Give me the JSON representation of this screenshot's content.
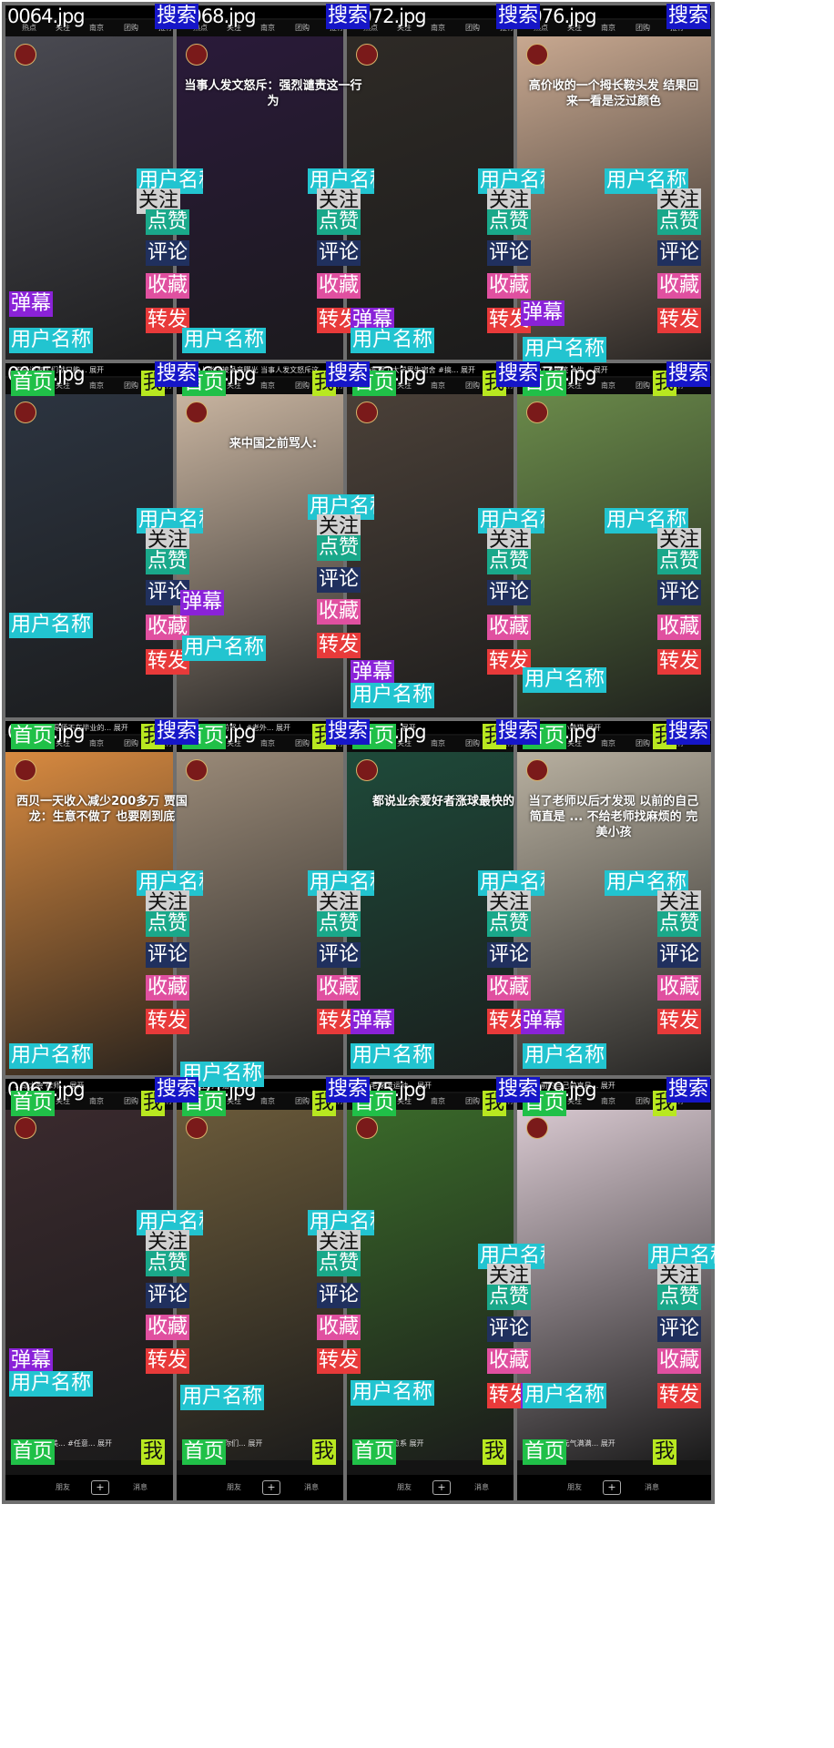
{
  "labels": {
    "search": "搜索",
    "user": "用户名称",
    "follow": "关注",
    "like": "点赞",
    "comment": "评论",
    "favorite": "收藏",
    "share": "转发",
    "danmu": "弹幕",
    "home": "首页",
    "me": "我"
  },
  "nav_tabs": [
    "热点",
    "关注",
    "南京",
    "团购",
    "推荐"
  ],
  "bottom_nav": [
    "朋友",
    "消息"
  ],
  "cells": [
    {
      "file": "0064.jpg",
      "bg": "#4a4a52",
      "text": "",
      "caption": "不是说家人们就只能... 展开"
    },
    {
      "file": "0068.jpg",
      "bg": "#2a1a3a",
      "text": "当事人发文怒斥：强烈谴责这一行为",
      "caption": "...私人谈话被录音曝光 当事人发文怒斥这一... 展开"
    },
    {
      "file": "0072.jpg",
      "bg": "#2e2a26",
      "text": "",
      "caption": "...山东理工大学男生宿舍 #搞... 展开"
    },
    {
      "file": "0076.jpg",
      "bg": "#c8a890",
      "text": "高价收的一个拇长鞍头发 结果回来一看是泛过颜色",
      "caption": "...烫了#搞笑 #生... 展开"
    },
    {
      "file": "0065.jpg",
      "bg": "#2c3440",
      "text": "",
      "caption": "不能硬碰了 是师不在毕业的... 展开"
    },
    {
      "file": "0069.jpg",
      "bg": "#c8b4a0",
      "text": "来中国之前骂人:",
      "caption": "...在中国之前骂人 #老外... 展开"
    },
    {
      "file": "0073.jpg",
      "bg": "#4a4038",
      "text": "",
      "caption": "...不去热门... 展开"
    },
    {
      "file": "0077.jpg",
      "bg": "#6a8a4a",
      "text": "",
      "caption": "...大熊猫的小熊猫 展开"
    },
    {
      "file": "0066.jpg",
      "bg": "#d88a40",
      "text": "西贝一天收入减少200多万 贾国龙：生意不做了 也要刚到底",
      "caption": "...战大会 律师... 展开"
    },
    {
      "file": "0070.jpg",
      "bg": "#9a8a78",
      "text": "",
      "caption": "...家里有个猫... 展开"
    },
    {
      "file": "0074.jpg",
      "bg": "#1e4a3a",
      "text": "都说业余爱好者涨球最快的",
      "caption": "...羽毛球 #运动... 展开"
    },
    {
      "file": "0078.jpg",
      "bg": "#b8b0a0",
      "text": "当了老师以后才发现 以前的自己简直是 ... 不给老师找麻烦的 完美小孩",
      "caption": "...以前的自己简直是... 展开"
    },
    {
      "file": "0067.jpg",
      "bg": "#3a2a2e",
      "text": "",
      "caption": "女神你有多美... #任意... 展开"
    },
    {
      "file": "0071.jpg",
      "bg": "#6a5a3a",
      "text": "",
      "caption": "...南京大学 你们... 展开"
    },
    {
      "file": "0075.jpg",
      "bg": "#3a6a2a",
      "text": "",
      "caption": "#壁纸 #治愈系 展开"
    },
    {
      "file": "0079.jpg",
      "bg": "#d8c8d0",
      "text": "",
      "caption": "...今天也是元气满满... 展开"
    }
  ]
}
